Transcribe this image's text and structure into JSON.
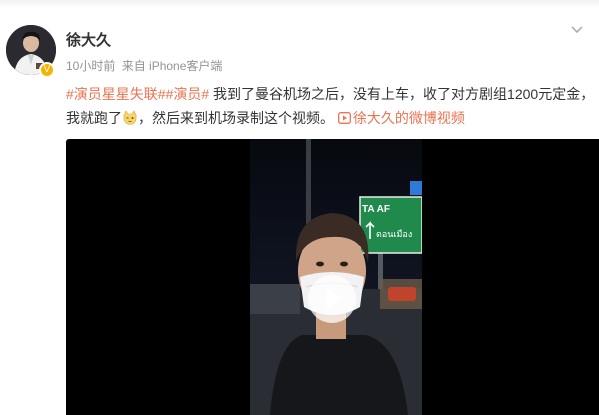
{
  "user": {
    "name": "徐大久",
    "time": "10小时前",
    "source": "来自 iPhone客户端"
  },
  "post": {
    "tag1": "#演员星星失联#",
    "tag2": "#演员#",
    "text1": " 我到了曼谷机场之后，没有上车，收了对方剧组1200元定金，我就跑了",
    "emoji": "wink-cat-emoji",
    "text2": "，然后来到机场录制这个视频。 ",
    "video_link": "徐大久的微博视频"
  },
  "video": {
    "sign_text": "TA  AF",
    "sign_script": "ดอนเมือง",
    "play_icon": "play-icon"
  },
  "colors": {
    "accent": "#eb7350",
    "name": "#333333",
    "meta": "#939393",
    "verified": "#f5b400"
  }
}
